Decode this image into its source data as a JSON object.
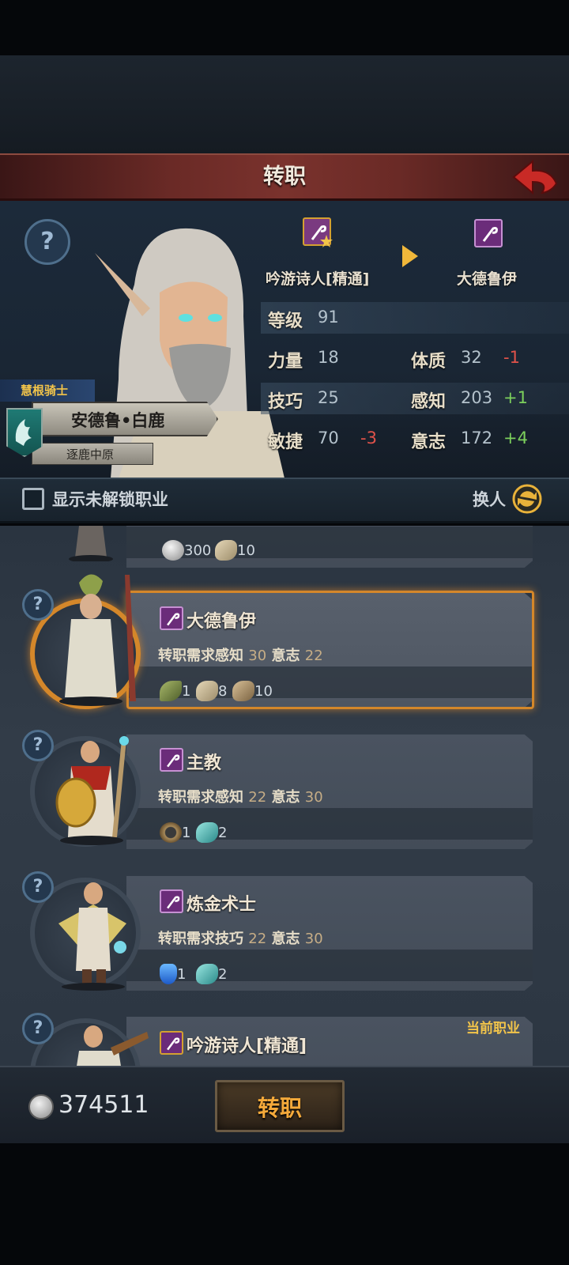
{
  "header": {
    "title": "转职"
  },
  "character": {
    "guild": "慧根骑士",
    "name": "安德鲁•白鹿",
    "subtitle": "逐鹿中原",
    "current_class": "吟游诗人[精通]",
    "target_class": "大德鲁伊"
  },
  "stats": {
    "level_label": "等级",
    "level_value": "91",
    "str_label": "力量",
    "str_value": "18",
    "con_label": "体质",
    "con_value": "32",
    "con_delta": "-1",
    "skill_label": "技巧",
    "skill_value": "25",
    "per_label": "感知",
    "per_value": "203",
    "per_delta": "+1",
    "agi_label": "敏捷",
    "agi_value": "70",
    "agi_delta": "-3",
    "will_label": "意志",
    "will_value": "172",
    "will_delta": "+4"
  },
  "toolbar": {
    "show_locked_label": "显示未解锁职业",
    "swap_label": "换人"
  },
  "jobs": [
    {
      "name": "",
      "req_prefix": "",
      "materials": [
        {
          "icon": "silver-coin-icon",
          "count": "300"
        },
        {
          "icon": "scroll-icon",
          "count": "10"
        }
      ]
    },
    {
      "name": "大德鲁伊",
      "req_prefix": "转职需求",
      "req": [
        {
          "stat": "感知",
          "value": "30"
        },
        {
          "stat": "意志",
          "value": "22"
        }
      ],
      "materials": [
        {
          "icon": "herb-icon",
          "count": "1"
        },
        {
          "icon": "scroll-icon",
          "count": "8"
        },
        {
          "icon": "wood-log-icon",
          "count": "10"
        }
      ]
    },
    {
      "name": "主教",
      "req_prefix": "转职需求",
      "req": [
        {
          "stat": "感知",
          "value": "22"
        },
        {
          "stat": "意志",
          "value": "30"
        }
      ],
      "materials": [
        {
          "icon": "ring-icon",
          "count": "1"
        },
        {
          "icon": "cyan-cloth-icon",
          "count": "2"
        }
      ]
    },
    {
      "name": "炼金术士",
      "req_prefix": "转职需求",
      "req": [
        {
          "stat": "技巧",
          "value": "22"
        },
        {
          "stat": "意志",
          "value": "30"
        }
      ],
      "materials": [
        {
          "icon": "potion-icon",
          "count": "1"
        },
        {
          "icon": "cyan-cloth-icon",
          "count": "2"
        }
      ]
    },
    {
      "name": "吟游诗人[精通]",
      "tag": "当前职业"
    }
  ],
  "footer": {
    "money": "374511",
    "confirm_label": "转职"
  },
  "colors": {
    "accent_orange": "#d4872a",
    "title_red": "#6a2a26",
    "panel_blue": "#1c2a3a"
  }
}
